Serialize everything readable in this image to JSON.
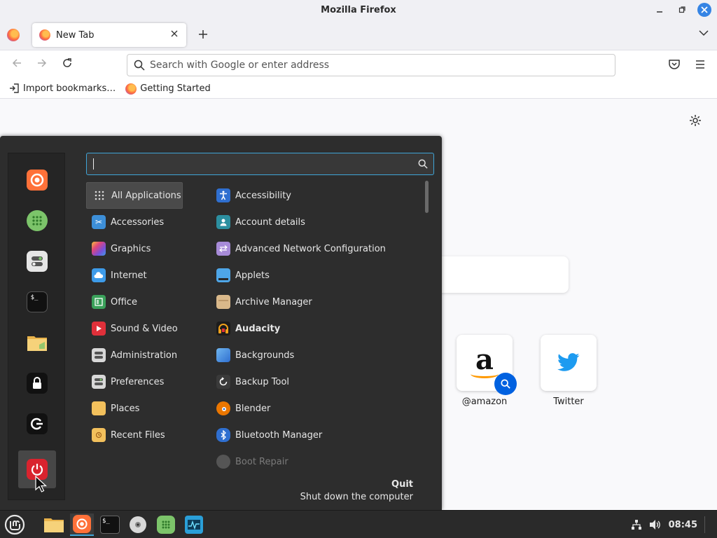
{
  "window": {
    "title": "Mozilla Firefox"
  },
  "tabs": [
    {
      "label": "New Tab"
    }
  ],
  "urlbar": {
    "placeholder": "Search with Google or enter address"
  },
  "bookmarks": [
    {
      "label": "Import bookmarks…"
    },
    {
      "label": "Getting Started"
    }
  ],
  "shortcuts": [
    {
      "label": "@amazon"
    },
    {
      "label": "Twitter"
    }
  ],
  "menu": {
    "search_value": "",
    "categories": [
      {
        "label": "All Applications",
        "icon": "grid-icon",
        "color": "#2d2d2d"
      },
      {
        "label": "Accessories",
        "icon": "scissors-icon",
        "color": "#3d8fd8"
      },
      {
        "label": "Graphics",
        "icon": "palette-icon",
        "color": "#e0457b"
      },
      {
        "label": "Internet",
        "icon": "cloud-icon",
        "color": "#3d9be9"
      },
      {
        "label": "Office",
        "icon": "document-icon",
        "color": "#3aa15a"
      },
      {
        "label": "Sound & Video",
        "icon": "play-icon",
        "color": "#e0303a"
      },
      {
        "label": "Administration",
        "icon": "toggle-icon",
        "color": "#d8d8d8"
      },
      {
        "label": "Preferences",
        "icon": "toggle-icon",
        "color": "#d8d8d8"
      },
      {
        "label": "Places",
        "icon": "folder-icon",
        "color": "#f2c05c"
      },
      {
        "label": "Recent Files",
        "icon": "recent-folder-icon",
        "color": "#f2c05c"
      }
    ],
    "apps": [
      {
        "label": "Accessibility",
        "icon": "accessibility-icon",
        "color": "#2f6fd0"
      },
      {
        "label": "Account details",
        "icon": "user-icon",
        "color": "#2c8fa0"
      },
      {
        "label": "Advanced Network Configuration",
        "icon": "network-arrows-icon",
        "color": "#a78bd8"
      },
      {
        "label": "Applets",
        "icon": "applets-icon",
        "color": "#4ea6e8"
      },
      {
        "label": "Archive Manager",
        "icon": "archive-icon",
        "color": "#d9b88a"
      },
      {
        "label": "Audacity",
        "icon": "headphones-icon",
        "color": "#f2a21a"
      },
      {
        "label": "Backgrounds",
        "icon": "image-icon",
        "color": "#3d86d8"
      },
      {
        "label": "Backup Tool",
        "icon": "backup-icon",
        "color": "#3a3a3a"
      },
      {
        "label": "Blender",
        "icon": "blender-icon",
        "color": "#ea7600"
      },
      {
        "label": "Bluetooth Manager",
        "icon": "bluetooth-icon",
        "color": "#2f6fd0"
      },
      {
        "label": "Boot Repair",
        "icon": "boot-repair-icon",
        "color": "#555555"
      }
    ],
    "quit": {
      "title": "Quit",
      "subtitle": "Shut down the computer"
    }
  },
  "favorites": [
    {
      "name": "firefox",
      "icon": "firefox-icon"
    },
    {
      "name": "software-manager",
      "icon": "software-manager-icon"
    },
    {
      "name": "system-settings",
      "icon": "settings-toggle-icon"
    },
    {
      "name": "terminal",
      "icon": "terminal-icon"
    },
    {
      "name": "files",
      "icon": "folder-icon"
    },
    {
      "name": "lock-screen",
      "icon": "lock-icon"
    },
    {
      "name": "logout",
      "icon": "logout-icon"
    },
    {
      "name": "shutdown",
      "icon": "power-icon"
    }
  ],
  "taskbar": {
    "clock": "08:45",
    "apps": [
      "files",
      "firefox",
      "terminal",
      "disc",
      "software-manager",
      "system-monitor"
    ]
  }
}
